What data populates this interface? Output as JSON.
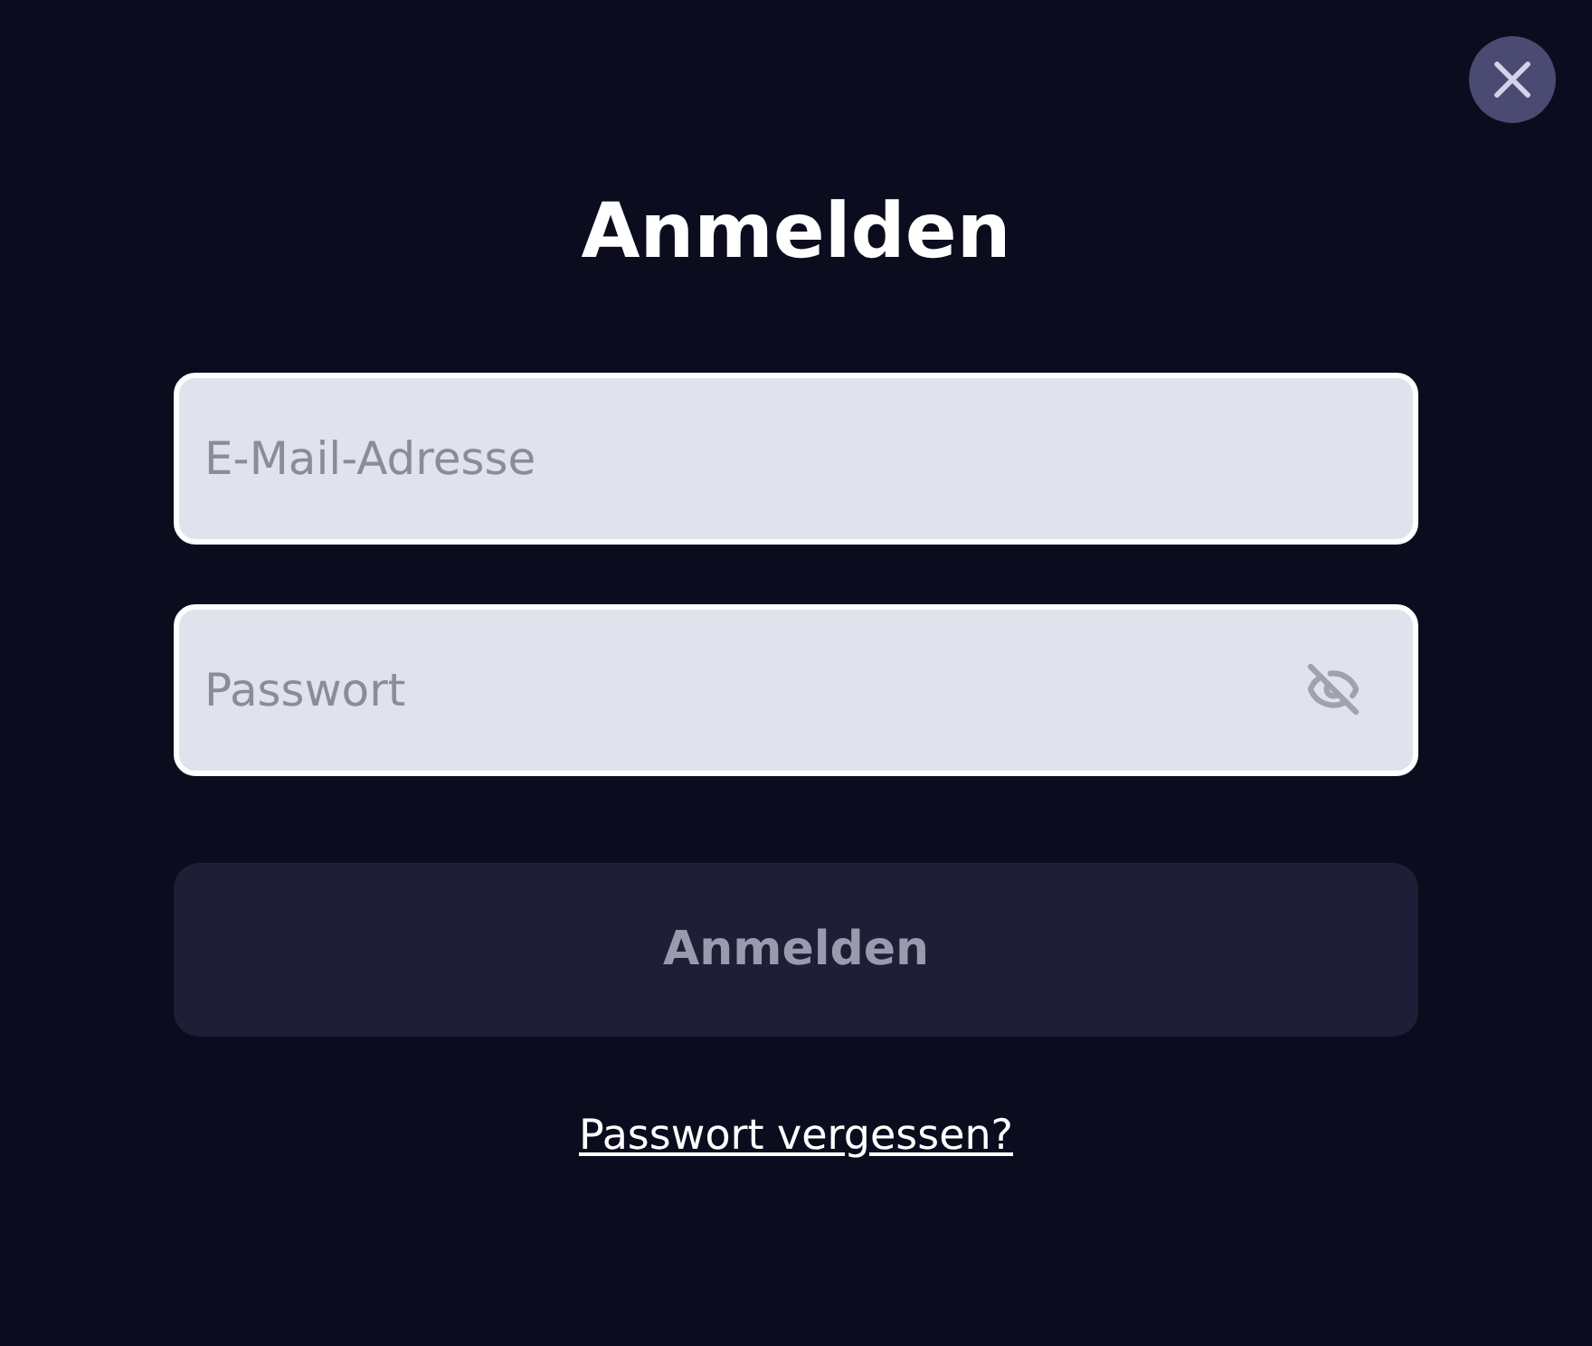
{
  "dialog": {
    "title": "Anmelden"
  },
  "fields": [
    {
      "kind": "text",
      "placeholder": "E-Mail-Adresse"
    },
    {
      "kind": "password",
      "placeholder": "Passwort"
    }
  ],
  "submit": {
    "label": "Anmelden",
    "disabled": true
  },
  "forgot_link": "Passwort vergessen?"
}
